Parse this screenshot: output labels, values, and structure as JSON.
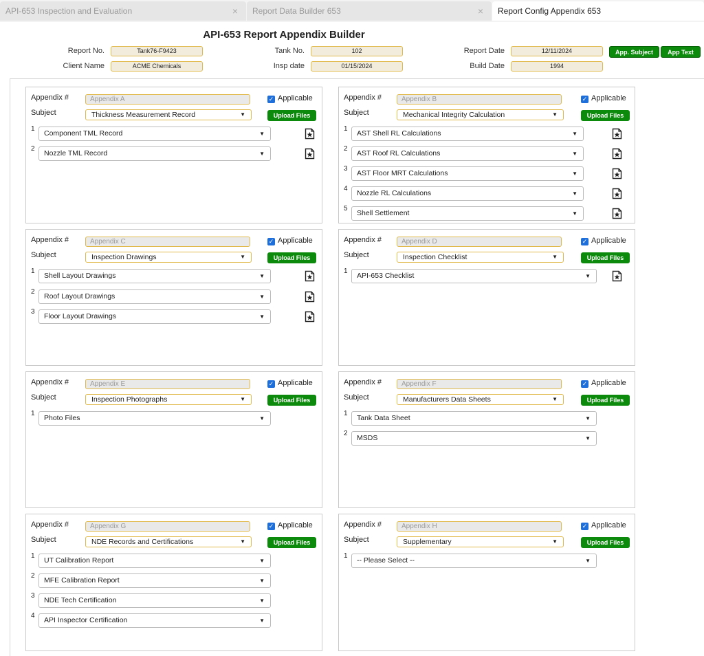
{
  "tabs": [
    {
      "label": "API-653 Inspection and Evaluation",
      "close": "×"
    },
    {
      "label": "Report Data Builder 653",
      "close": "×"
    },
    {
      "label": "Report Config Appendix 653"
    }
  ],
  "title": "API-653 Report Appendix Builder",
  "header": {
    "report_no_label": "Report No.",
    "report_no": "Tank76-F9423",
    "client_label": "Client Name",
    "client": "ACME Chemicals",
    "tank_no_label": "Tank No.",
    "tank_no": "102",
    "insp_date_label": "Insp date",
    "insp_date": "01/15/2024",
    "report_date_label": "Report Date",
    "report_date": "12/11/2024",
    "build_date_label": "Build Date",
    "build_date": "1994",
    "app_subject_btn": "App. Subject",
    "app_text_btn": "App Text"
  },
  "labels": {
    "appendix": "Appendix #",
    "subject": "Subject",
    "applicable": "Applicable",
    "upload": "Upload Files"
  },
  "colors": {
    "accent_green": "#0b8a0b",
    "field_border": "#e1b94a",
    "checkbox": "#1e6fd9"
  },
  "appendices": [
    {
      "name": "Appendix A",
      "subject": "Thickness Measurement Record",
      "applicable": true,
      "items": [
        "Component TML Record",
        "Nozzle TML Record"
      ]
    },
    {
      "name": "Appendix B",
      "subject": "Mechanical Integrity Calculation",
      "applicable": true,
      "items": [
        "AST Shell RL Calculations",
        "AST Roof RL Calculations",
        "AST Floor MRT Calculations",
        "Nozzle RL Calculations",
        "Shell Settlement"
      ]
    },
    {
      "name": "Appendix C",
      "subject": "Inspection Drawings",
      "applicable": true,
      "items": [
        "Shell Layout Drawings",
        "Roof Layout Drawings",
        "Floor Layout Drawings"
      ]
    },
    {
      "name": "Appendix D",
      "subject": "Inspection Checklist",
      "applicable": true,
      "items": [
        "API-653 Checklist"
      ]
    },
    {
      "name": "Appendix E",
      "subject": "Inspection Photographs",
      "applicable": true,
      "items": [
        "Photo Files"
      ]
    },
    {
      "name": "Appendix F",
      "subject": "Manufacturers Data Sheets",
      "applicable": true,
      "items": [
        "Tank Data Sheet",
        "MSDS"
      ]
    },
    {
      "name": "Appendix G",
      "subject": "NDE Records and Certifications",
      "applicable": true,
      "items": [
        "UT Calibration Report",
        "MFE Calibration Report",
        "NDE Tech Certification",
        "API Inspector Certification"
      ]
    },
    {
      "name": "Appendix H",
      "subject": "Supplementary",
      "applicable": true,
      "items": [
        "-- Please Select --"
      ]
    }
  ]
}
